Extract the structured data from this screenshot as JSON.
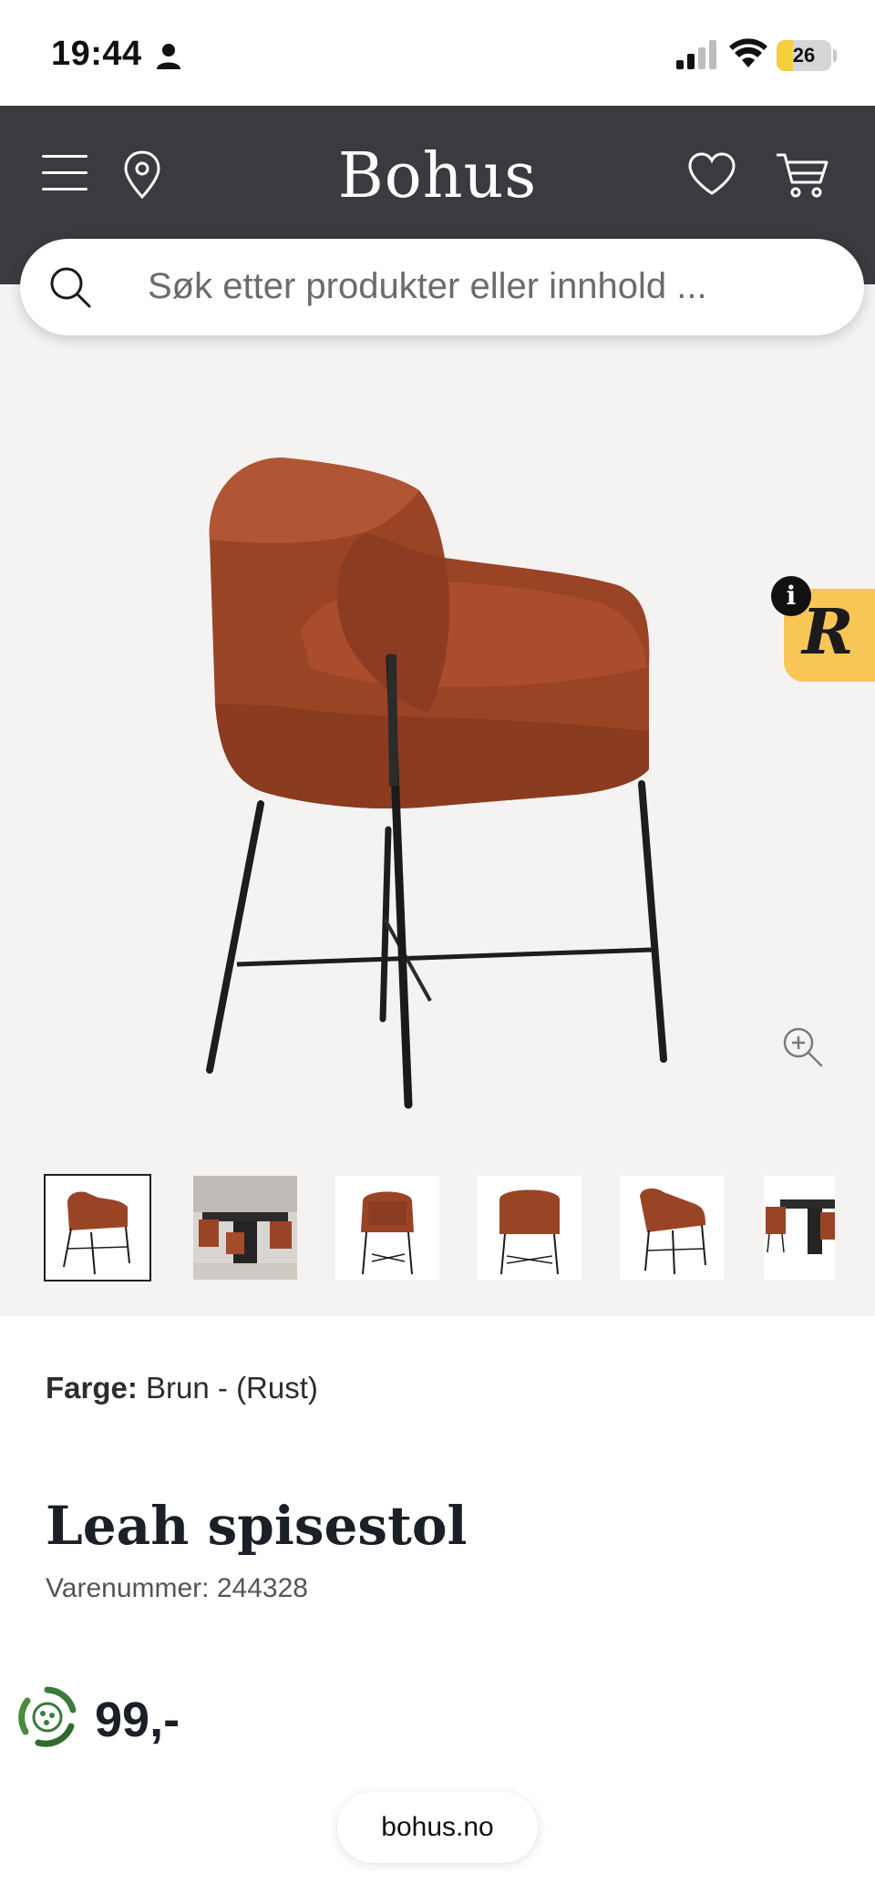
{
  "status_bar": {
    "time": "19:44",
    "battery_level": "26"
  },
  "header": {
    "brand": "Bohus"
  },
  "search": {
    "placeholder": "Søk etter produkter eller innhold ..."
  },
  "gallery": {
    "thumbnail_count": 6,
    "selected_index": 0,
    "widget_letter": "R",
    "info_badge": "i"
  },
  "product": {
    "color_label": "Farge:",
    "color_value": "Brun - (Rust)",
    "title": "Leah spisestol",
    "sku_label": "Varenummer:",
    "sku_value": "244328",
    "price": "99,-"
  },
  "browser": {
    "url": "bohus.no"
  },
  "colors": {
    "header_bg": "#3a3b3f",
    "gallery_bg": "#f5f3f1",
    "chair_fabric": "#9c4527",
    "widget_yellow": "#f7c657",
    "eco_green": "#3a7a3a"
  }
}
